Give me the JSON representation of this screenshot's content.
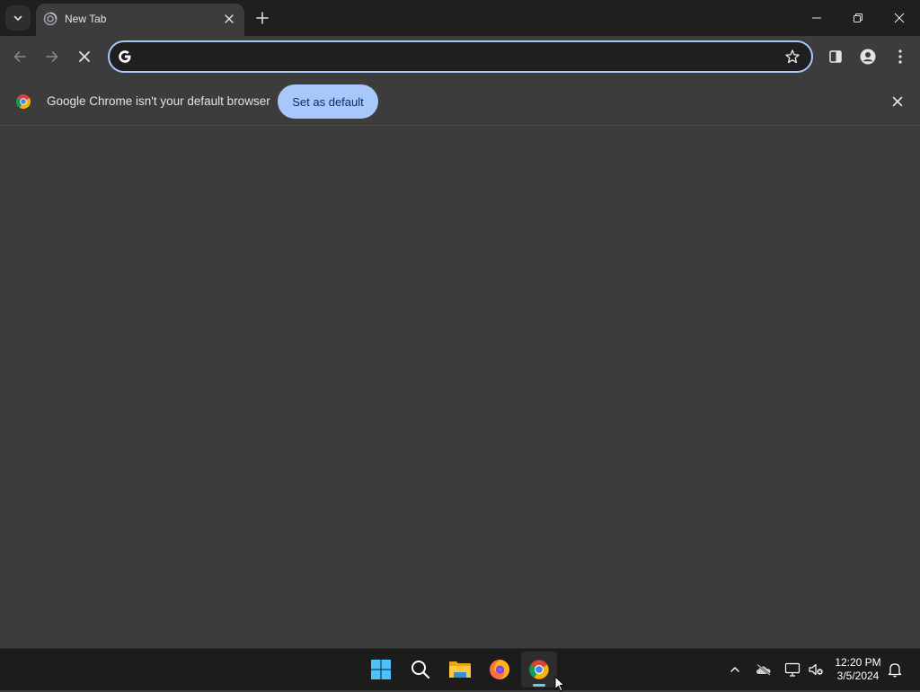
{
  "tabs": [
    {
      "title": "New Tab",
      "icon": "chrome-loading-icon"
    }
  ],
  "tab_search": {
    "icon": "chevron-down-icon"
  },
  "new_tab": {
    "icon": "plus-icon"
  },
  "window_controls": [
    "minimize-icon",
    "restore-icon",
    "close-icon"
  ],
  "toolbar": {
    "back_icon": "arrow-left-icon",
    "forward_icon": "arrow-right-icon",
    "stop_icon": "close-icon",
    "omnibox": {
      "value": "",
      "placeholder": "",
      "search_icon": "google-g-icon",
      "bookmark_icon": "star-icon"
    },
    "side_panel_icon": "side-panel-icon",
    "profile_icon": "person-icon",
    "menu_icon": "kebab-menu-icon"
  },
  "infobar": {
    "message": "Google Chrome isn't your default browser",
    "button_label": "Set as default",
    "icon": "chrome-logo-icon"
  },
  "taskbar": {
    "apps": [
      {
        "name": "start",
        "icon": "windows-logo-icon"
      },
      {
        "name": "search",
        "icon": "search-icon"
      },
      {
        "name": "file-explorer",
        "icon": "folder-icon"
      },
      {
        "name": "firefox",
        "icon": "firefox-icon"
      },
      {
        "name": "chrome",
        "icon": "chrome-logo-icon",
        "active": true
      }
    ],
    "tray": [
      "chevron-up-icon",
      "onedrive-offline-icon",
      "network-icon",
      "volume-muted-icon"
    ],
    "time": "12:20 PM",
    "date": "3/5/2024",
    "notification_icon": "bell-icon"
  },
  "colors": {
    "frame": "#1f1f1f",
    "toolbar": "#3c3c3c",
    "accent": "#a8c7fa",
    "taskbar": "#1c1c1c"
  }
}
